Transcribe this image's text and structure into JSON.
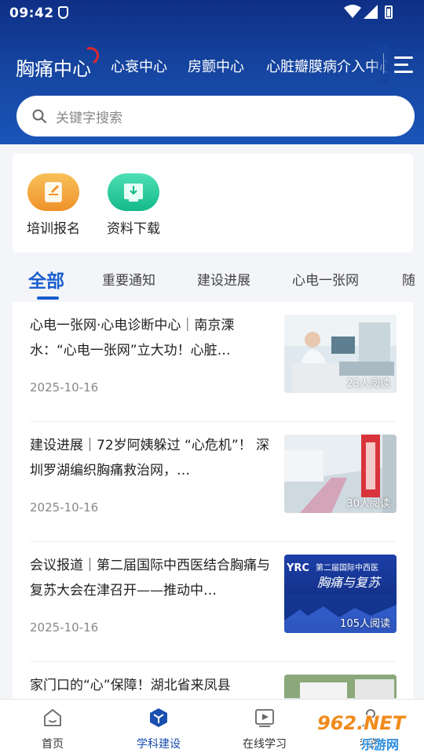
{
  "status_bar": {
    "time": "09:42"
  },
  "nav": {
    "active_tab": "胸痛中心",
    "tabs": [
      "心衰中心",
      "房颤中心",
      "心脏瓣膜病介入中心"
    ]
  },
  "search": {
    "placeholder": "关键字搜索"
  },
  "quick_actions": [
    {
      "label": "培训报名",
      "icon": "edit-document-icon",
      "color": "#f5a13a"
    },
    {
      "label": "资料下载",
      "icon": "download-icon",
      "color": "#22c89a"
    }
  ],
  "categories": {
    "active": "全部",
    "items": [
      "重要通知",
      "建设进展",
      "心电一张网",
      "随"
    ]
  },
  "news": [
    {
      "title": "心电一张网·心电诊断中心｜南京溧水：“心电一张网”立大功！心脏…",
      "date": "2025-10-16",
      "reads": "23人阅读"
    },
    {
      "title": "建设进展｜72岁阿姨躲过 “心危机”！ 深圳罗湖编织胸痛救治网，…",
      "date": "2025-10-16",
      "reads": "30人阅读"
    },
    {
      "title": "会议报道｜第二届国际中西医结合胸痛与复苏大会在津召开——推动中…",
      "date": "2025-10-16",
      "reads": "105人阅读",
      "thumb_text": "第二届国际中西医",
      "thumb_text2": "胸痛与复苏",
      "thumb_text3": "YRC"
    },
    {
      "title": "家门口的“心”保障！湖北省来凤县",
      "date": "",
      "reads": ""
    }
  ],
  "bottom_nav": [
    {
      "label": "首页",
      "icon": "home-icon",
      "active": false
    },
    {
      "label": "学科建设",
      "icon": "discipline-icon",
      "active": true
    },
    {
      "label": "在线学习",
      "icon": "video-play-icon",
      "active": false
    },
    {
      "label": "我的",
      "icon": "user-icon",
      "active": false
    }
  ],
  "watermark": {
    "text": "962.NET",
    "subtext": "乐游网"
  },
  "colors": {
    "header": "#15449f",
    "accent": "#1a5ecf",
    "logo_arc": "#e0262f"
  }
}
